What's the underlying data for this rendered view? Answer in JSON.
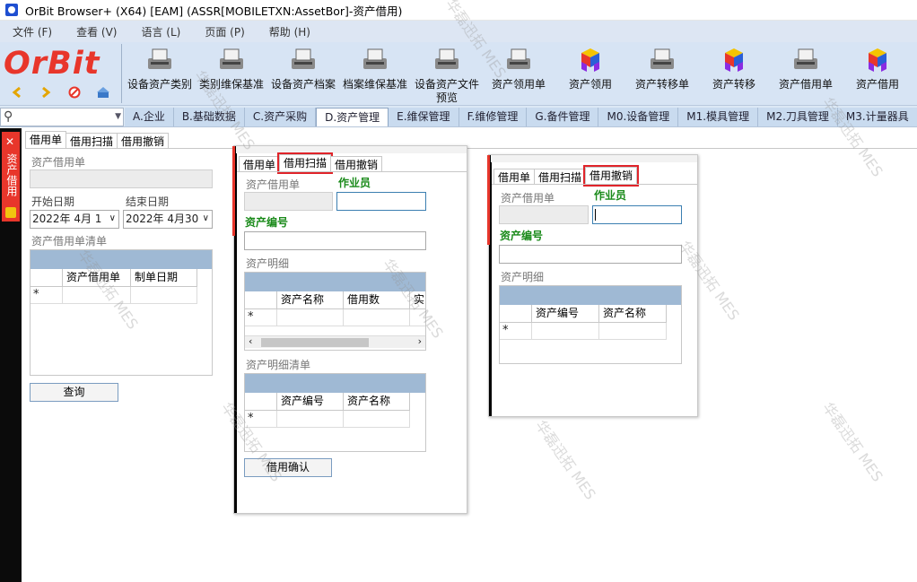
{
  "window": {
    "title": "OrBit Browser+ (X64) [EAM] (ASSR[MOBILETXN:AssetBor]-资产借用)"
  },
  "menu": [
    "文件 (F)",
    "查看 (V)",
    "语言 (L)",
    "页面 (P)",
    "帮助 (H)"
  ],
  "logo": "OrBit",
  "toolbar": [
    {
      "label": "设备资产类别",
      "icon": "printer-icon"
    },
    {
      "label": "类别维保基准",
      "icon": "printer-icon"
    },
    {
      "label": "设备资产档案",
      "icon": "printer-icon"
    },
    {
      "label": "档案维保基准",
      "icon": "printer-icon"
    },
    {
      "label": "设备资产文件预览",
      "icon": "printer-icon"
    },
    {
      "label": "资产领用单",
      "icon": "printer-icon"
    },
    {
      "label": "资产领用",
      "icon": "cubes-icon"
    },
    {
      "label": "资产转移单",
      "icon": "printer-icon"
    },
    {
      "label": "资产转移",
      "icon": "cubes-icon"
    },
    {
      "label": "资产借用单",
      "icon": "printer-icon"
    },
    {
      "label": "资产借用",
      "icon": "cubes-icon"
    }
  ],
  "module_tabs": [
    "A.企业",
    "B.基础数据",
    "C.资产采购",
    "D.资产管理",
    "E.维保管理",
    "F.维修管理",
    "G.备件管理",
    "M0.设备管理",
    "M1.模具管理",
    "M2.刀具管理",
    "M3.计量器具"
  ],
  "active_module": "D.资产管理",
  "side_tab": {
    "label": "资产借用"
  },
  "inner_tabs": [
    "借用单",
    "借用扫描",
    "借用撤销"
  ],
  "form1": {
    "doc_label": "资产借用单",
    "start_label": "开始日期",
    "end_label": "结束日期",
    "start_value": "2022年  4月  1",
    "end_value": "2022年  4月30",
    "list_label": "资产借用单清单",
    "columns": [
      "资产借用单",
      "制单日期"
    ],
    "new_row_marker": "*",
    "query_button": "查询"
  },
  "form2": {
    "doc_label": "资产借用单",
    "operator_label": "作业员",
    "asset_no_label": "资产编号",
    "detail_label": "资产明细",
    "detail_columns": [
      "资产名称",
      "借用数",
      "实"
    ],
    "list_label": "资产明细清单",
    "list_columns": [
      "资产编号",
      "资产名称"
    ],
    "new_row_marker": "*",
    "confirm_button": "借用确认"
  },
  "form3": {
    "doc_label": "资产借用单",
    "operator_label": "作业员",
    "asset_no_label": "资产编号",
    "detail_label": "资产明细",
    "detail_columns": [
      "资产编号",
      "资产名称"
    ],
    "new_row_marker": "*"
  },
  "watermark": "华磊迅拓 MES",
  "colors": {
    "brand_red": "#e8362b",
    "highlight": "#e0242a",
    "grid_bar": "#9fb9d4",
    "green_label": "#1a8a1a"
  }
}
